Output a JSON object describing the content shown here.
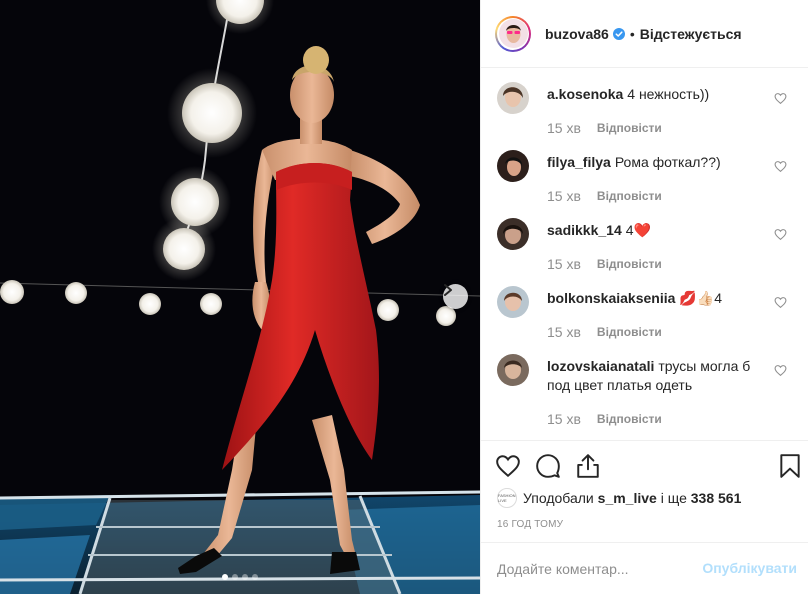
{
  "post": {
    "username": "buzova86",
    "separator": "•",
    "follow_status": "Відстежується",
    "verified_icon": "verified-badge-icon",
    "accent": "#3897f0"
  },
  "carousel": {
    "next_icon": "chevron-right-icon",
    "total_slides": 4,
    "active_slide": 1
  },
  "comments": [
    {
      "user": "a.kosenoka",
      "text": "4 нежность))",
      "time": "15 хв",
      "reply": "Відповісти"
    },
    {
      "user": "filya_filya",
      "text": "Рома фоткал??)",
      "time": "15 хв",
      "reply": "Відповісти"
    },
    {
      "user": "sadikkk_14",
      "text": "4❤️",
      "time": "15 хв",
      "reply": "Відповісти"
    },
    {
      "user": "bolkonskaiakseniia",
      "text": "💋👍🏻4",
      "time": "15 хв",
      "reply": "Відповісти"
    },
    {
      "user": "lozovskaianatali",
      "text": "трусы могла б под цвет платья одеть",
      "time": "15 хв",
      "reply": "Відповісти"
    }
  ],
  "actions": {
    "like_icon": "heart-icon",
    "comment_icon": "comment-bubble-icon",
    "share_icon": "share-icon",
    "save_icon": "bookmark-icon"
  },
  "likes": {
    "prefix": "Уподобали",
    "user": "s_m_live",
    "middle": "і ще",
    "count": "338 561",
    "avatar_text": "FASHION LIVE"
  },
  "timestamp": "16 ГОД ТОМУ",
  "comment_box": {
    "placeholder": "Додайте коментар...",
    "publish_label": "Опублікувати",
    "publish_color": "#b2dffc"
  }
}
